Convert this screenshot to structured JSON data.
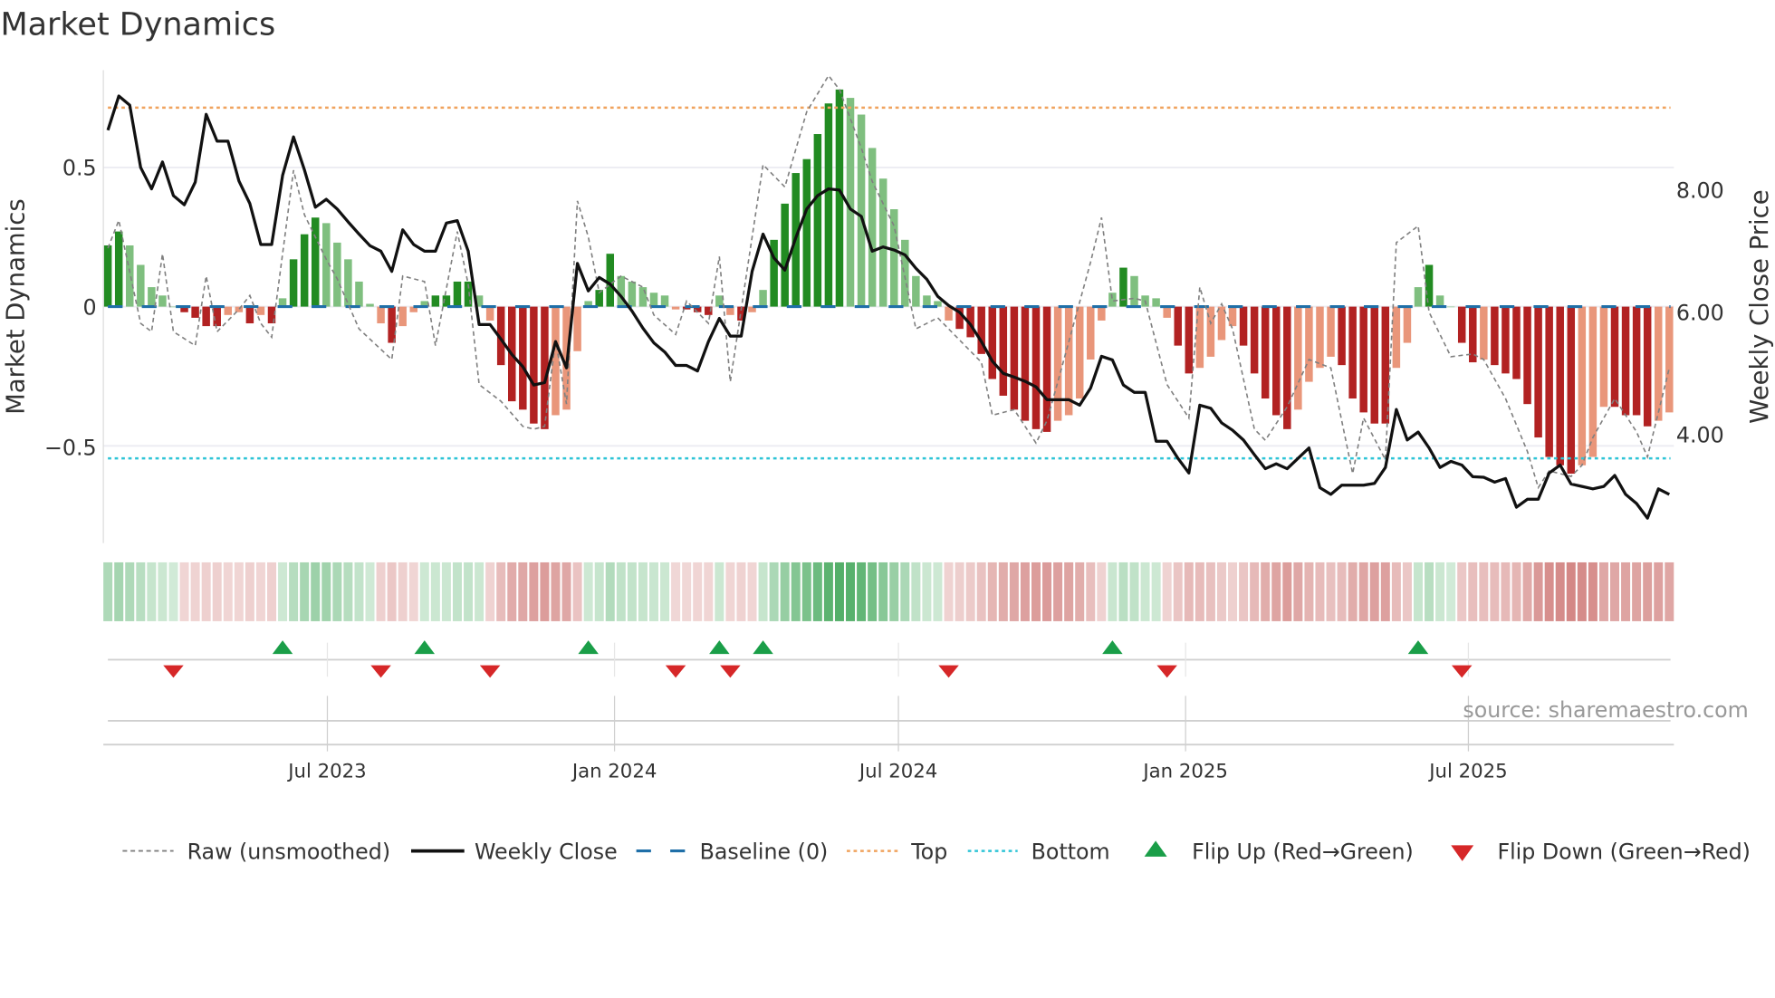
{
  "title": "Market Dynamics",
  "source": "source: sharemaestro.com",
  "colors": {
    "green_dark": "#228b22",
    "green_light": "#7fbf7f",
    "red_dark": "#b22222",
    "red_light": "#e9967a",
    "raw": "#808080",
    "close": "#111111",
    "baseline": "#1f6fa8",
    "top": "#f0a35e",
    "bottom": "#2ec4d6",
    "flip_up": "#1a9e48",
    "flip_down": "#d62728",
    "heat_green": "#2e9e48",
    "heat_red": "#c0504d"
  },
  "chart_data": {
    "type": "bar",
    "title": "Market Dynamics",
    "ylabel": "Market Dynamics",
    "y2label": "Weekly Close Price",
    "x_unit": "week index (weekly bars, ~Feb 2023 to Nov 2025)",
    "ylim": [
      -0.85,
      0.85
    ],
    "y2lim": [
      2.2,
      10.0
    ],
    "y_ticks": [
      {
        "value": 0.5,
        "label": "0.5"
      },
      {
        "value": 0,
        "label": "0"
      },
      {
        "value": -0.5,
        "label": "−0.5"
      }
    ],
    "y2_ticks": [
      {
        "value": 8,
        "label": "8.00"
      },
      {
        "value": 6,
        "label": "6.00"
      },
      {
        "value": 4,
        "label": "4.00"
      }
    ],
    "x_ticks": [
      {
        "week": 20.1,
        "label": "Jul 2023"
      },
      {
        "week": 46.4,
        "label": "Jan 2024"
      },
      {
        "week": 72.4,
        "label": "Jul 2024"
      },
      {
        "week": 98.7,
        "label": "Jan 2025"
      },
      {
        "week": 124.6,
        "label": "Jul 2025"
      }
    ],
    "top_level": 0.715,
    "bottom_level": -0.545,
    "baseline": 0,
    "bars": [
      0.22,
      0.27,
      0.22,
      0.15,
      0.07,
      0.04,
      0.0,
      -0.02,
      -0.04,
      -0.07,
      -0.07,
      -0.03,
      -0.02,
      -0.06,
      -0.03,
      -0.06,
      0.03,
      0.17,
      0.26,
      0.32,
      0.3,
      0.23,
      0.17,
      0.09,
      0.01,
      -0.06,
      -0.13,
      -0.07,
      -0.02,
      0.02,
      0.04,
      0.04,
      0.09,
      0.09,
      0.04,
      -0.05,
      -0.21,
      -0.34,
      -0.37,
      -0.42,
      -0.44,
      -0.39,
      -0.37,
      -0.16,
      0.02,
      0.06,
      0.19,
      0.11,
      0.09,
      0.07,
      0.05,
      0.04,
      -0.01,
      -0.01,
      -0.02,
      -0.03,
      0.04,
      -0.03,
      -0.05,
      -0.02,
      0.06,
      0.24,
      0.37,
      0.48,
      0.53,
      0.62,
      0.73,
      0.78,
      0.75,
      0.69,
      0.57,
      0.46,
      0.35,
      0.24,
      0.11,
      0.04,
      0.02,
      -0.05,
      -0.08,
      -0.11,
      -0.17,
      -0.26,
      -0.32,
      -0.37,
      -0.41,
      -0.44,
      -0.45,
      -0.41,
      -0.39,
      -0.33,
      -0.19,
      -0.05,
      0.05,
      0.14,
      0.11,
      0.04,
      0.03,
      -0.04,
      -0.14,
      -0.24,
      -0.22,
      -0.18,
      -0.12,
      -0.07,
      -0.14,
      -0.24,
      -0.33,
      -0.39,
      -0.44,
      -0.37,
      -0.27,
      -0.22,
      -0.18,
      -0.21,
      -0.33,
      -0.38,
      -0.42,
      -0.42,
      -0.22,
      -0.13,
      0.07,
      0.15,
      0.04,
      0.0,
      -0.13,
      -0.2,
      -0.19,
      -0.21,
      -0.24,
      -0.26,
      -0.35,
      -0.47,
      -0.54,
      -0.57,
      -0.6,
      -0.57,
      -0.54,
      -0.36,
      -0.36,
      -0.39,
      -0.39,
      -0.43,
      -0.41,
      -0.38
    ],
    "weekly_close": [
      8.98,
      9.54,
      9.39,
      8.37,
      8.02,
      8.46,
      7.91,
      7.76,
      8.13,
      9.24,
      8.8,
      8.8,
      8.15,
      7.78,
      7.11,
      7.11,
      8.24,
      8.87,
      8.33,
      7.72,
      7.85,
      7.69,
      7.48,
      7.28,
      7.09,
      7.0,
      6.67,
      7.35,
      7.11,
      7.0,
      7.0,
      7.46,
      7.5,
      7.0,
      5.8,
      5.8,
      5.56,
      5.31,
      5.11,
      4.81,
      4.85,
      5.52,
      5.09,
      6.8,
      6.35,
      6.57,
      6.46,
      6.26,
      6.02,
      5.74,
      5.5,
      5.35,
      5.13,
      5.13,
      5.04,
      5.52,
      5.9,
      5.61,
      5.61,
      6.67,
      7.28,
      6.89,
      6.69,
      7.22,
      7.69,
      7.91,
      8.02,
      8.0,
      7.69,
      7.57,
      7.0,
      7.07,
      7.02,
      6.94,
      6.72,
      6.54,
      6.26,
      6.11,
      6.0,
      5.8,
      5.52,
      5.2,
      5.0,
      4.94,
      4.87,
      4.78,
      4.57,
      4.57,
      4.57,
      4.48,
      4.76,
      5.28,
      5.22,
      4.81,
      4.69,
      4.69,
      3.89,
      3.89,
      3.61,
      3.37,
      4.48,
      4.43,
      4.19,
      4.07,
      3.91,
      3.67,
      3.44,
      3.52,
      3.44,
      3.61,
      3.78,
      3.13,
      3.02,
      3.17,
      3.17,
      3.17,
      3.2,
      3.46,
      4.41,
      3.91,
      4.04,
      3.78,
      3.46,
      3.56,
      3.5,
      3.31,
      3.3,
      3.22,
      3.28,
      2.81,
      2.94,
      2.94,
      3.37,
      3.5,
      3.19,
      3.15,
      3.11,
      3.15,
      3.33,
      3.02,
      2.87,
      2.63,
      3.11,
      3.02
    ],
    "raw_points": [
      [
        0,
        0.21
      ],
      [
        1,
        0.31
      ],
      [
        3,
        -0.06
      ],
      [
        4,
        -0.09
      ],
      [
        5,
        0.19
      ],
      [
        6,
        -0.09
      ],
      [
        8,
        -0.14
      ],
      [
        9,
        0.11
      ],
      [
        10,
        -0.09
      ],
      [
        12,
        -0.01
      ],
      [
        13,
        0.04
      ],
      [
        14,
        -0.06
      ],
      [
        15,
        -0.11
      ],
      [
        17,
        0.49
      ],
      [
        18,
        0.33
      ],
      [
        20,
        0.17
      ],
      [
        21,
        0.1
      ],
      [
        23,
        -0.08
      ],
      [
        26,
        -0.19
      ],
      [
        27,
        0.11
      ],
      [
        29,
        0.09
      ],
      [
        30,
        -0.14
      ],
      [
        32,
        0.27
      ],
      [
        33,
        0.08
      ],
      [
        34,
        -0.28
      ],
      [
        36,
        -0.34
      ],
      [
        38,
        -0.43
      ],
      [
        39,
        -0.44
      ],
      [
        40,
        -0.43
      ],
      [
        41,
        -0.12
      ],
      [
        42,
        -0.35
      ],
      [
        43,
        0.38
      ],
      [
        44,
        0.25
      ],
      [
        45,
        0.05
      ],
      [
        47,
        0.11
      ],
      [
        49,
        0.07
      ],
      [
        50,
        -0.03
      ],
      [
        52,
        -0.1
      ],
      [
        53,
        0.02
      ],
      [
        55,
        -0.06
      ],
      [
        56,
        0.18
      ],
      [
        57,
        -0.27
      ],
      [
        60,
        0.51
      ],
      [
        62,
        0.43
      ],
      [
        64,
        0.7
      ],
      [
        66,
        0.83
      ],
      [
        67,
        0.78
      ],
      [
        69,
        0.57
      ],
      [
        70,
        0.45
      ],
      [
        72,
        0.29
      ],
      [
        74,
        -0.08
      ],
      [
        76,
        -0.04
      ],
      [
        78,
        -0.12
      ],
      [
        80,
        -0.2
      ],
      [
        81,
        -0.39
      ],
      [
        83,
        -0.37
      ],
      [
        85,
        -0.49
      ],
      [
        86,
        -0.41
      ],
      [
        87,
        -0.27
      ],
      [
        90,
        0.16
      ],
      [
        91,
        0.32
      ],
      [
        92,
        0.02
      ],
      [
        94,
        0.03
      ],
      [
        95,
        0.02
      ],
      [
        97,
        -0.28
      ],
      [
        99,
        -0.4
      ],
      [
        100,
        0.07
      ],
      [
        101,
        -0.06
      ],
      [
        102,
        0.01
      ],
      [
        103,
        -0.08
      ],
      [
        105,
        -0.44
      ],
      [
        106,
        -0.48
      ],
      [
        108,
        -0.36
      ],
      [
        110,
        -0.19
      ],
      [
        112,
        -0.22
      ],
      [
        114,
        -0.6
      ],
      [
        115,
        -0.4
      ],
      [
        117,
        -0.55
      ],
      [
        118,
        0.23
      ],
      [
        120,
        0.29
      ],
      [
        121,
        -0.02
      ],
      [
        123,
        -0.18
      ],
      [
        125,
        -0.17
      ],
      [
        126,
        -0.19
      ],
      [
        128,
        -0.33
      ],
      [
        130,
        -0.52
      ],
      [
        131,
        -0.65
      ],
      [
        132,
        -0.59
      ],
      [
        134,
        -0.61
      ],
      [
        135,
        -0.57
      ],
      [
        136,
        -0.47
      ],
      [
        138,
        -0.33
      ],
      [
        140,
        -0.45
      ],
      [
        141,
        -0.54
      ],
      [
        143,
        -0.22
      ]
    ],
    "flip_up_weeks": [
      16,
      29,
      44,
      56,
      60,
      92,
      120
    ],
    "flip_down_weeks": [
      6,
      25,
      35,
      52,
      57,
      77,
      97,
      124
    ],
    "legend_position": "bottom",
    "legend": [
      {
        "key": "raw",
        "label": "Raw (unsmoothed)"
      },
      {
        "key": "close",
        "label": "Weekly Close"
      },
      {
        "key": "baseline",
        "label": "Baseline (0)"
      },
      {
        "key": "top",
        "label": "Top"
      },
      {
        "key": "bottom",
        "label": "Bottom"
      },
      {
        "key": "flip_up",
        "label": "Flip Up (Red→Green)"
      },
      {
        "key": "flip_down",
        "label": "Flip Down (Green→Red)"
      }
    ]
  }
}
